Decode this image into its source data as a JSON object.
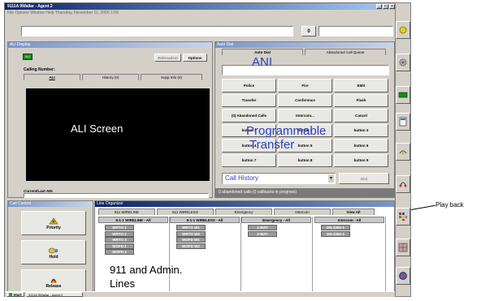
{
  "window": {
    "title": "9111A 9Wallar - Agent 2",
    "menu": "File  Options  Window  Help   Thursday, November 11, 2006  1:56",
    "counter": "0"
  },
  "ali_panel": {
    "title": "ALI Display",
    "status_badge": "ALI",
    "rebid_label": "Rebroadcst",
    "options_label": "Options",
    "calling_number_label": "Calling Number:",
    "tabs": [
      "ALI",
      "History (0)",
      "Supp Info (0)"
    ],
    "screen_label": "ALI Screen",
    "current_ani_label": "Current/Last ANI"
  },
  "auto_dial": {
    "title": "Auto Dial",
    "tabs": [
      "Auto Dial",
      "Abandoned Call Queue"
    ],
    "ani_label": "ANI",
    "buttons": [
      "Police",
      "Fire",
      "EMS",
      "Transfer",
      "Conference",
      "Flash",
      "(0) Abandoned Calls",
      "Intercom...",
      "Cancel",
      "button 1",
      "button 2",
      "button 3",
      "button 4",
      "button 5",
      "button 6",
      "button 7",
      "button 8",
      "button 9"
    ],
    "overlay_programmable": "Programmable",
    "overlay_transfer": "Transfer",
    "call_history_value": "Call History",
    "dial_label": "Dial",
    "status_text": "0 abandoned calls (0 callbacks in progress)"
  },
  "call_control": {
    "title": "Call Control",
    "buttons": [
      "Priority",
      "Hold",
      "Release"
    ]
  },
  "line_organizer": {
    "title": "Line Organizer",
    "top_tabs": [
      "911 WIRELINE",
      "911 WIRELESS",
      "Emergency",
      "Intercom",
      "View All"
    ],
    "columns": [
      {
        "header": "9-1-1 WIRELINE - All",
        "lines": [
          "WRTO 1",
          "WRTO 2",
          "WRTO 3",
          "WOFD 1",
          "WOFD 2"
        ]
      },
      {
        "header": "9-1-1 WIRELESS - All",
        "lines": [
          "WRTO W1",
          "WRTO W2",
          "WOFD W1",
          "WOFD W2"
        ]
      },
      {
        "header": "Emergency - All",
        "lines": [
          "1-WAY",
          "2-WAY"
        ]
      },
      {
        "header": "Intercom - All",
        "lines": [
          "DN 2282-1",
          "DN 2282-2"
        ]
      }
    ],
    "overlay_label_1": "911 and Admin.",
    "overlay_label_2": "Lines"
  },
  "taskbar": {
    "start_label": "Start",
    "task_label": "9111A 9Wallar - Agent 2"
  },
  "annotation": {
    "playback_label": "Play back"
  },
  "colors": {
    "accent_blue": "#2d3fbf",
    "title_gradient_start": "#0a246a",
    "panel_gray": "#d4d0c8",
    "status_green": "#1a8a1a"
  }
}
